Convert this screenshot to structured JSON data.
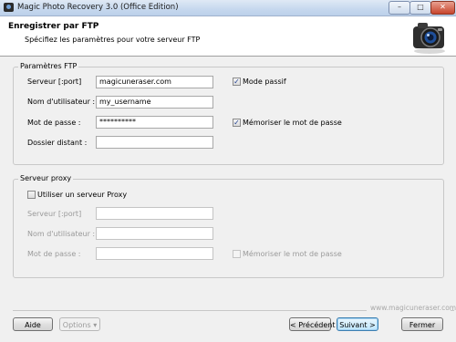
{
  "window": {
    "title": "Magic Photo Recovery 3.0 (Office Edition)",
    "minimize": "–",
    "maximize": "□",
    "close": "✕"
  },
  "header": {
    "title": "Enregistrer par FTP",
    "subtitle": "Spécifiez les paramètres pour votre serveur FTP"
  },
  "ftp": {
    "legend": "Paramètres FTP",
    "server_label": "Serveur [:port]",
    "server_value": "magicuneraser.com",
    "user_label": "Nom d'utilisateur :",
    "user_value": "my_username",
    "password_label": "Mot de passe :",
    "password_value": "**********",
    "remote_dir_label": "Dossier distant :",
    "remote_dir_value": "",
    "passive_mode_label": "Mode passif",
    "passive_mode_checked": true,
    "remember_password_label": "Mémoriser le mot de passe",
    "remember_password_checked": true
  },
  "proxy": {
    "legend": "Serveur proxy",
    "use_proxy_label": "Utiliser un serveur Proxy",
    "use_proxy_checked": false,
    "server_label": "Serveur [:port]",
    "user_label": "Nom d'utilisateur :",
    "password_label": "Mot de passe :",
    "remember_password_label": "Mémoriser le mot de passe"
  },
  "footer": {
    "brand_url": "www.magicuneraser.com",
    "help": "Aide",
    "options": "Options ▾",
    "previous": "< Précédent",
    "next": "Suivant >",
    "close": "Fermer"
  },
  "colors": {
    "accent": "#3c7fb1",
    "disabled_text": "#9a9a9a"
  }
}
